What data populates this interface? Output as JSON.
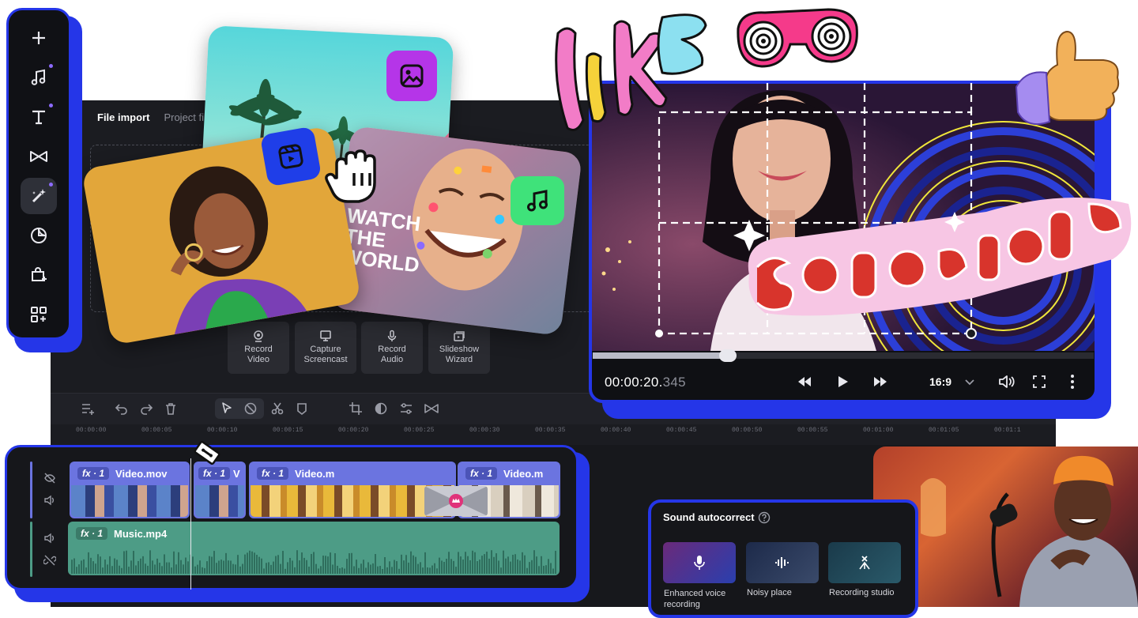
{
  "sidebar": {
    "tools": [
      {
        "name": "add-icon",
        "dot": false
      },
      {
        "name": "music-note-icon",
        "dot": true
      },
      {
        "name": "text-icon",
        "dot": true
      },
      {
        "name": "transitions-icon",
        "dot": false
      },
      {
        "name": "magic-effects-icon",
        "dot": true
      },
      {
        "name": "stickers-icon",
        "dot": false
      },
      {
        "name": "store-icon",
        "dot": false
      },
      {
        "name": "more-apps-icon",
        "dot": false
      }
    ]
  },
  "import": {
    "tabs": [
      "File import",
      "Project file"
    ],
    "actions": [
      {
        "line1": "Record",
        "line2": "Video",
        "icon": "webcam-icon"
      },
      {
        "line1": "Capture",
        "line2": "Screencast",
        "icon": "monitor-icon"
      },
      {
        "line1": "Record",
        "line2": "Audio",
        "icon": "microphone-icon"
      },
      {
        "line1": "Slideshow",
        "line2": "Wizard",
        "icon": "slideshow-icon"
      }
    ]
  },
  "cards": {
    "watch_text": [
      "WATCH",
      "THE",
      "WORLD"
    ]
  },
  "stickers": {
    "like": "LIKE",
    "subscribe": "SUBSCRIBE"
  },
  "player": {
    "timecode_main": "00:00:20.",
    "timecode_ms": "345",
    "aspect_ratio": "16:9",
    "progress": 0.27
  },
  "timeline": {
    "ruler": [
      "00:00:00",
      "00:00:05",
      "00:00:10",
      "00:00:15",
      "00:00:20",
      "00:00:25",
      "00:00:30",
      "00:00:35",
      "00:00:40",
      "00:00:45",
      "00:00:50",
      "00:00:55",
      "00:01:00",
      "00:01:05",
      "00:01:1"
    ],
    "fx_label": "fx · 1",
    "clips": [
      {
        "name": "Video.mov"
      },
      {
        "name": "V"
      },
      {
        "name": "Video.m"
      },
      {
        "name": "Video.m"
      }
    ],
    "music_clip": {
      "name": "Music.mp4"
    }
  },
  "sound_autocorrect": {
    "title": "Sound autocorrect",
    "presets": [
      "Enhanced voice recording",
      "Noisy place",
      "Recording studio"
    ]
  },
  "colors": {
    "accent": "#2536e8",
    "video_clip": "#6b74e0",
    "music_clip": "#4d9c86"
  }
}
